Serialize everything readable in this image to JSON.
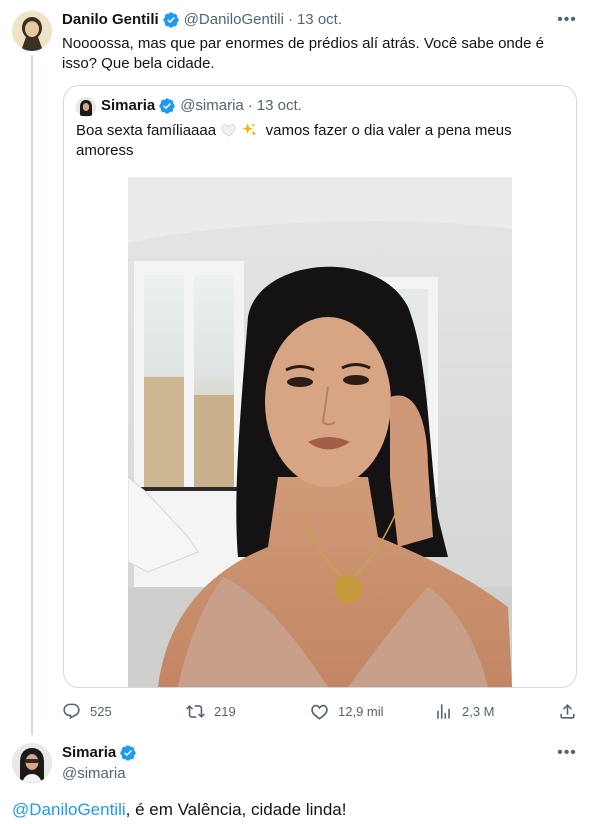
{
  "main_tweet": {
    "display_name": "Danilo Gentili",
    "handle": "@DaniloGentili",
    "separator": "·",
    "date": "13 oct.",
    "text": "Noooossa, mas que par enormes de prédios alí atrás. Você sabe onde é isso? Que bela cidade."
  },
  "quoted_tweet": {
    "display_name": "Simaria",
    "handle": "@simaria",
    "separator": "·",
    "date": "13 oct.",
    "text_before_emoji": "Boa sexta famíliaaaa",
    "text_after_emoji": "vamos fazer o dia valer a pena meus amoress",
    "emojis": [
      "white-heart",
      "sparkles"
    ]
  },
  "actions": {
    "replies": "525",
    "retweets": "219",
    "likes": "12,9 mil",
    "views": "2,3 M"
  },
  "reply_tweet": {
    "display_name": "Simaria",
    "handle": "@simaria",
    "mention": "@DaniloGentili",
    "text": ", é em Valência, cidade linda!"
  },
  "icons": [
    "verified-badge-icon",
    "more-options-icon",
    "reply-icon",
    "retweet-icon",
    "like-icon",
    "views-icon",
    "share-icon"
  ],
  "colors": {
    "verified": "#1d9bf0",
    "link": "#1d9bf0",
    "secondary_text": "#536471",
    "border": "#cfd9de"
  }
}
